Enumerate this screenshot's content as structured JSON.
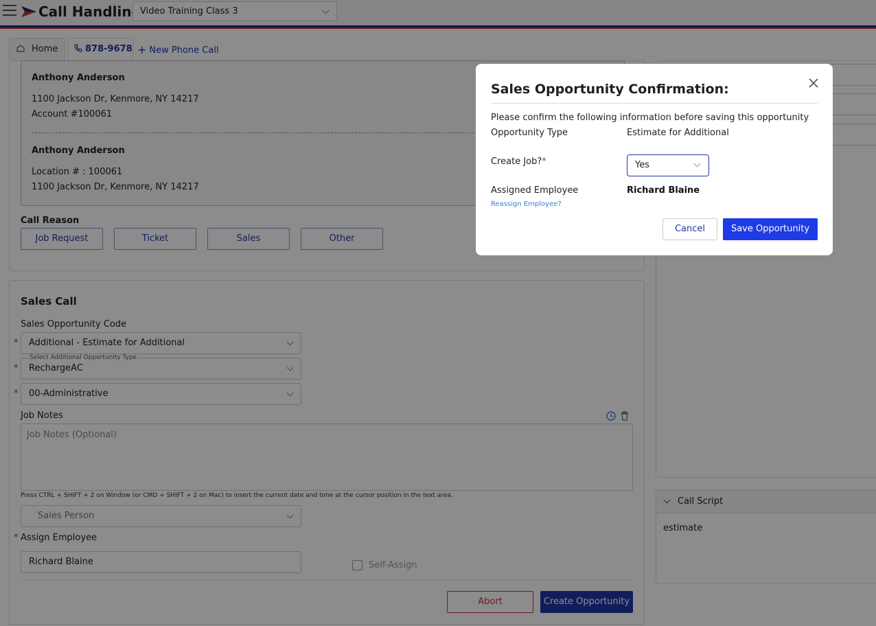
{
  "header": {
    "app_title": "Call Handling",
    "company_select": "Video Training Class 3",
    "menu_icon": "hamburger-menu-icon",
    "logo_icon": "arrow-logo-icon",
    "brand_colors": {
      "navy": "#1a2a6c",
      "red": "#c8323a",
      "accent": "#2236a8"
    }
  },
  "tabs": {
    "home_label": "Home",
    "phone_label": "878-9678",
    "new_call_label": "New Phone Call"
  },
  "customer": {
    "account_name": "Anthony Anderson",
    "account_address": "1100 Jackson Dr, Kenmore, NY 14217",
    "account_number": "Account #100061",
    "location_name": "Anthony Anderson",
    "location_number": "Location # : 100061",
    "location_address": "1100 Jackson Dr, Kenmore, NY 14217"
  },
  "call_reason": {
    "title": "Call Reason",
    "buttons": [
      "Job Request",
      "Ticket",
      "Sales",
      "Other"
    ]
  },
  "sales_call": {
    "title": "Sales Call",
    "opportunity_code_label": "Sales Opportunity Code",
    "opportunity_code_value": "Additional - Estimate for Additional",
    "additional_type_label": "Select Additional Opportunity Type",
    "additional_type_value": "RechargeAC",
    "department_value": "00-Administrative",
    "job_notes_label": "Job Notes",
    "job_notes_placeholder": "Job Notes (Optional)",
    "notes_hint": "Press CTRL + SHIFT + 2 on Window (or CMD + SHIFT + 2 on Mac) to insert the current date and time at the cursor position in the text area.",
    "sales_person_placeholder": "Sales Person",
    "assign_employee_label": "Assign Employee",
    "assign_employee_value": "Richard Blaine",
    "self_assign_label": "Self-Assign",
    "required_mark": "*",
    "abort_label": "Abort",
    "create_label": "Create Opportunity"
  },
  "call_script": {
    "title": "Call Script",
    "body": "estimate"
  },
  "modal": {
    "title": "Sales Opportunity Confirmation:",
    "intro": "Please confirm the following information before saving this opportunity",
    "type_label": "Opportunity Type",
    "type_value": "Estimate for Additional",
    "create_job_label": "Create Job?",
    "required_mark": "*",
    "create_job_value": "Yes",
    "assigned_label": "Assigned Employee",
    "assigned_value": "Richard Blaine",
    "reassign_link": "Reassign Employee?",
    "cancel_label": "Cancel",
    "save_label": "Save Opportunity"
  }
}
